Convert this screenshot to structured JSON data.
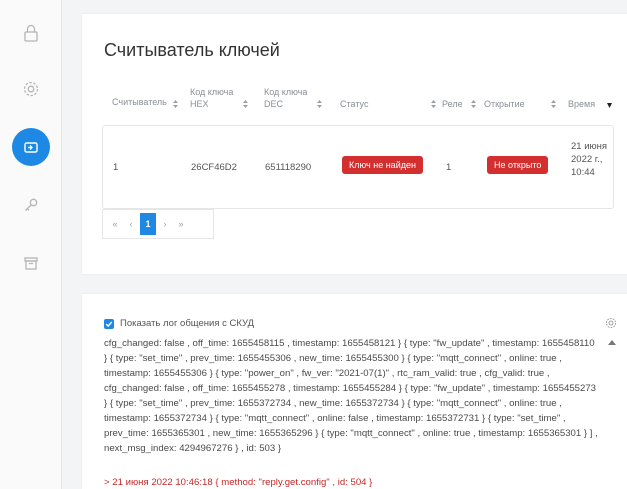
{
  "sidebar": {
    "items": [
      {
        "icon": "lock-icon"
      },
      {
        "icon": "gear-icon"
      },
      {
        "icon": "card-reader-icon",
        "active": true
      },
      {
        "icon": "key-icon"
      },
      {
        "icon": "archive-icon"
      }
    ]
  },
  "reader": {
    "title": "Считыватель ключей",
    "columns": {
      "reader": "Считыватель",
      "hex": "Код ключа HEX",
      "dec": "Код ключа DEC",
      "status": "Статус",
      "relay": "Реле",
      "opening": "Открытие",
      "time": "Время"
    },
    "row": {
      "reader": "1",
      "hex": "26CF46D2",
      "dec": "651118290",
      "status": "Ключ не найден",
      "relay": "1",
      "opening": "Не открыто",
      "time": "21 июня 2022 г., 10:44"
    },
    "pager": {
      "first": "«",
      "prev": "‹",
      "page": "1",
      "next": "›",
      "last": "»"
    }
  },
  "log": {
    "toggle_label": "Показать лог общения с СКУД",
    "text": "cfg_changed: false , off_time: 1655458115 , timestamp: 1655458121 } { type: \"fw_update\" , timestamp: 1655458110 } { type: \"set_time\" , prev_time: 1655455306 , new_time: 1655455300 } { type: \"mqtt_connect\" , online: true , timestamp: 1655455306 } { type: \"power_on\" , fw_ver: \"2021-07(1)\" , rtc_ram_valid: true , cfg_valid: true , cfg_changed: false , off_time: 1655455278 , timestamp: 1655455284 } { type: \"fw_update\" , timestamp: 1655455273 } { type: \"set_time\" , prev_time: 1655372734 , new_time: 1655372734 } { type: \"mqtt_connect\" , online: true , timestamp: 1655372734 } { type: \"mqtt_connect\" , online: false , timestamp: 1655372731 } { type: \"set_time\" , prev_time: 1655365301 , new_time: 1655365296 } { type: \"mqtt_connect\" , online: true , timestamp: 1655365301 } ] , next_msg_index: 4294967276 } , id: 503 }",
    "last_line": "> 21 июня 2022 10:46:18 { method: \"reply.get.config\" , id: 504 }"
  },
  "colors": {
    "accent": "#1e88e5",
    "danger": "#d32f2f"
  }
}
